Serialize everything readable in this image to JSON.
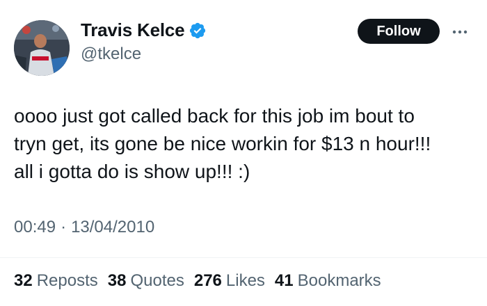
{
  "user": {
    "display_name": "Travis Kelce",
    "handle": "@tkelce",
    "verified_color": "#1d9bf0"
  },
  "follow_button": {
    "label": "Follow"
  },
  "more_menu": {
    "icon": "more-icon"
  },
  "tweet": {
    "lines": [
      "oooo just got called back for this job im bout to",
      "tryn get, its gone be nice workin for $13 n hour!!!",
      "all i gotta do is show up!!! :)"
    ],
    "time": "00:49",
    "separator": "·",
    "date": "13/04/2010"
  },
  "stats": {
    "reposts": {
      "count": "32",
      "label": "Reposts"
    },
    "quotes": {
      "count": "38",
      "label": "Quotes"
    },
    "likes": {
      "count": "276",
      "label": "Likes"
    },
    "bookmarks": {
      "count": "41",
      "label": "Bookmarks"
    }
  }
}
